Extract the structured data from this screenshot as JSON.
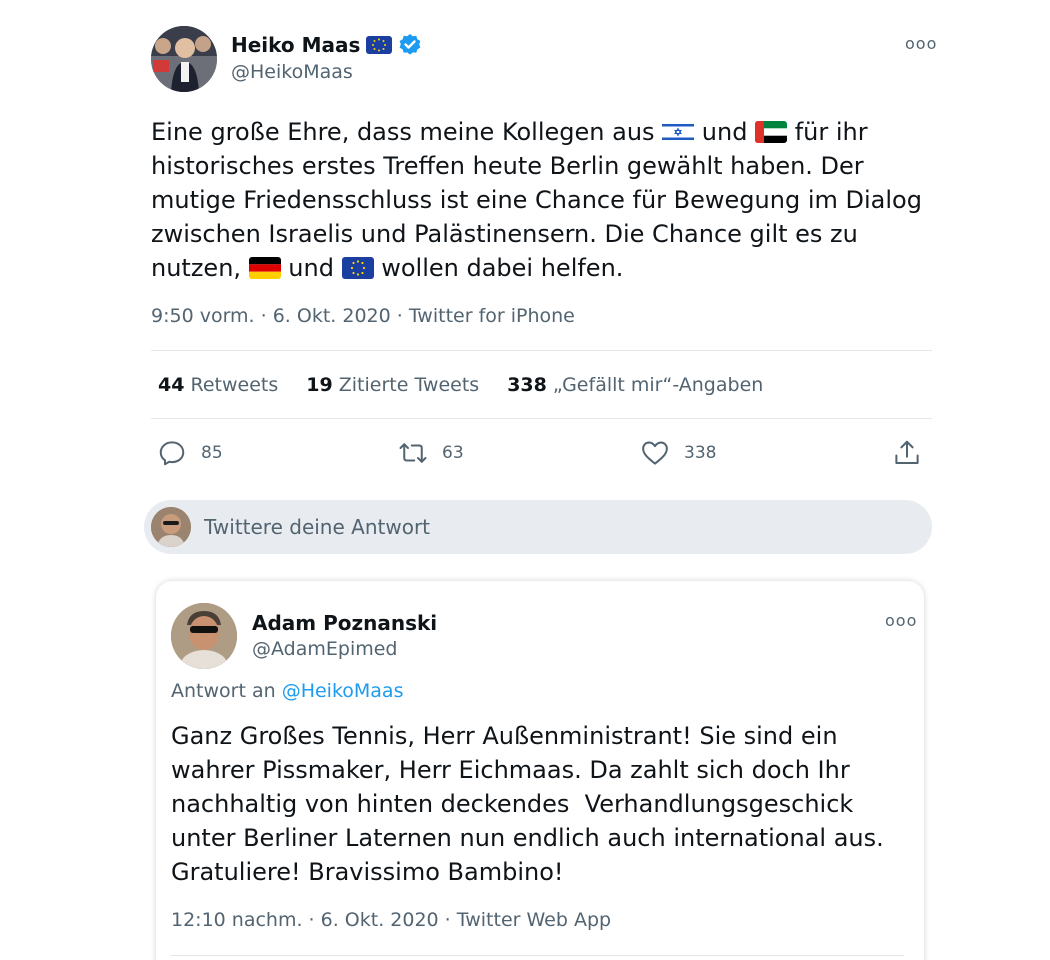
{
  "main_tweet": {
    "author_name": "Heiko Maas",
    "author_handle": "@HeikoMaas",
    "more_label": "ooo",
    "text_parts": {
      "p1": "Eine große Ehre, dass meine Kollegen aus ",
      "p2": " und ",
      "p3": " für ihr historisches erstes Treffen heute Berlin gewählt haben. Der mutige Friedensschluss ist eine Chance für Bewegung im Dialog zwischen Israelis und Palästinensern. Die Chance gilt es zu nutzen, ",
      "p4": " und ",
      "p5": " wollen dabei helfen."
    },
    "flags": [
      "israel-flag",
      "uae-flag",
      "germany-flag",
      "eu-flag"
    ],
    "timestamp": "9:50 vorm. · 6. Okt. 2020 · Twitter for iPhone",
    "stats": {
      "retweets_count": "44",
      "retweets_label": "Retweets",
      "quotes_count": "19",
      "quotes_label": "Zitierte Tweets",
      "likes_count": "338",
      "likes_label": "„Gefällt mir“-Angaben"
    },
    "actions": {
      "replies": "85",
      "retweets": "63",
      "likes": "338"
    }
  },
  "reply_composer": {
    "placeholder": "Twittere deine Antwort"
  },
  "reply_tweet": {
    "author_name": "Adam Poznanski",
    "author_handle": "@AdamEpimed",
    "more_label": "ooo",
    "reply_prefix": "Antwort an ",
    "reply_to_handle": "@HeikoMaas",
    "text": "Ganz Großes Tennis, Herr Außenministrant! Sie sind ein wahrer Pissmaker, Herr Eichmaas. Da zahlt sich doch Ihr nachhaltig von hinten deckendes  Verhandlungsgeschick unter Berliner Laternen nun endlich auch international aus. Gratuliere! Bravissimo Bambino!",
    "timestamp": "12:10 nachm. · 6. Okt. 2020 · Twitter Web App"
  },
  "colors": {
    "accent": "#1d9bf0",
    "secondary_text": "#536471",
    "composer_bg": "#e8ecf0"
  }
}
